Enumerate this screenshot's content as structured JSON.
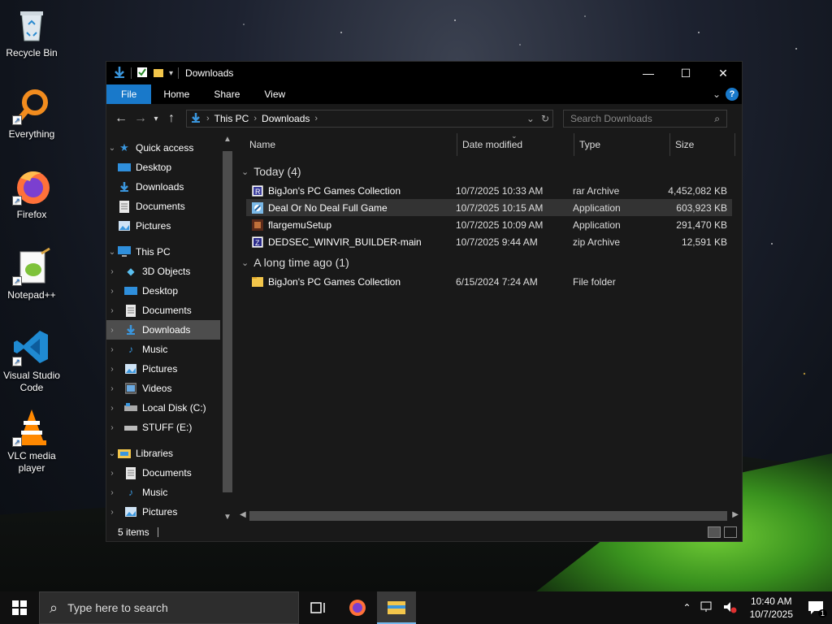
{
  "desktop": {
    "icons": [
      {
        "label": "Recycle Bin"
      },
      {
        "label": "Everything"
      },
      {
        "label": "Firefox"
      },
      {
        "label": "Notepad++"
      },
      {
        "label": "Visual Studio Code"
      },
      {
        "label": "VLC media player"
      }
    ]
  },
  "window": {
    "title": "Downloads",
    "ribbon_tabs": [
      "File",
      "Home",
      "Share",
      "View"
    ],
    "address": {
      "segments": [
        "This PC",
        "Downloads"
      ]
    },
    "search": {
      "placeholder": "Search Downloads"
    },
    "nav": {
      "quick_access": "Quick access",
      "quick_items": [
        "Desktop",
        "Downloads",
        "Documents",
        "Pictures"
      ],
      "this_pc": "This PC",
      "pc_items": [
        "3D Objects",
        "Desktop",
        "Documents",
        "Downloads",
        "Music",
        "Pictures",
        "Videos",
        "Local Disk (C:)",
        "STUFF (E:)"
      ],
      "libraries": "Libraries",
      "lib_items": [
        "Documents",
        "Music",
        "Pictures"
      ]
    },
    "columns": {
      "name": "Name",
      "date": "Date modified",
      "type": "Type",
      "size": "Size"
    },
    "groups": [
      {
        "label": "Today (4)",
        "files": [
          {
            "name": "BigJon's PC Games Collection",
            "date": "10/7/2025 10:33 AM",
            "type": "rar Archive",
            "size": "4,452,082 KB",
            "icon": "rar-icon"
          },
          {
            "name": "Deal Or No Deal Full Game",
            "date": "10/7/2025 10:15 AM",
            "type": "Application",
            "size": "603,923 KB",
            "icon": "app-icon"
          },
          {
            "name": "flargemuSetup",
            "date": "10/7/2025 10:09 AM",
            "type": "Application",
            "size": "291,470 KB",
            "icon": "setup-icon"
          },
          {
            "name": "DEDSEC_WINVIR_BUILDER-main",
            "date": "10/7/2025 9:44 AM",
            "type": "zip Archive",
            "size": "12,591 KB",
            "icon": "zip-icon"
          }
        ]
      },
      {
        "label": "A long time ago (1)",
        "files": [
          {
            "name": "BigJon's PC Games Collection",
            "date": "6/15/2024 7:24 AM",
            "type": "File folder",
            "size": "",
            "icon": "folder-icon"
          }
        ]
      }
    ],
    "status": "5 items"
  },
  "taskbar": {
    "search_placeholder": "Type here to search",
    "time": "10:40 AM",
    "date": "10/7/2025",
    "notification_count": "1"
  },
  "colors": {
    "accent": "#1979ca",
    "folder": "#f3c64b"
  }
}
